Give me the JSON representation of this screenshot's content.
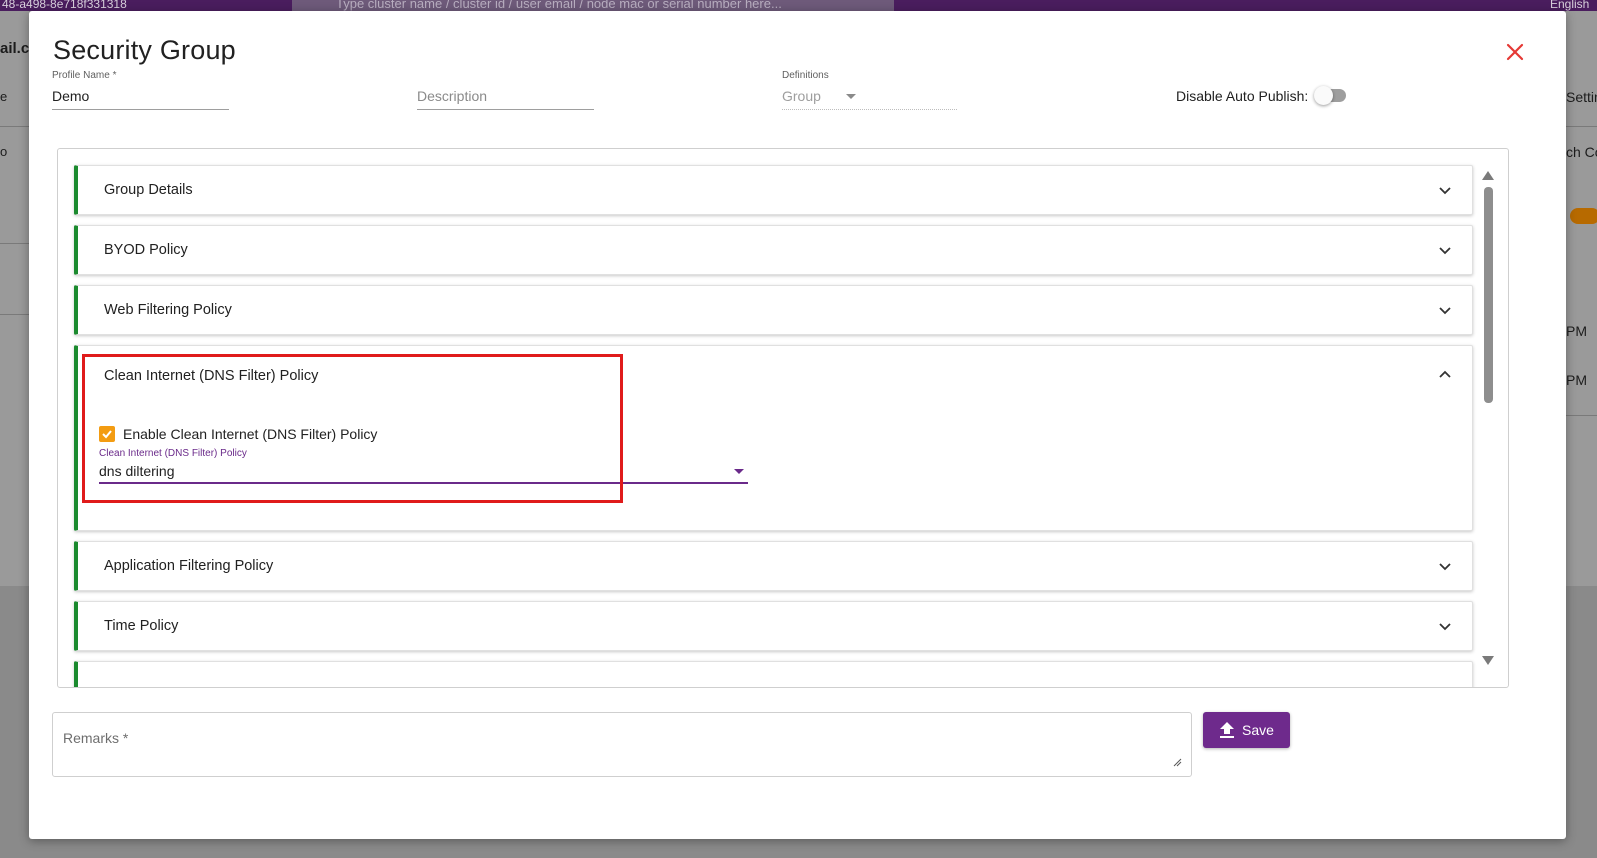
{
  "background": {
    "topbar_left_text": "48-a498-8e718f331318",
    "search_placeholder": "Type cluster name / cluster id / user email / node mac or serial number here...",
    "topbar_right_text": "English",
    "left_label": "ail.co",
    "left_label_2": "e",
    "left_label_3": "o",
    "right_label_settings": "Settin",
    "right_label_search": "ch Co",
    "right_label_pm1": "PM",
    "right_label_pm2": "PM"
  },
  "dialog": {
    "title": "Security Group",
    "profile_name": {
      "label": "Profile Name *",
      "value": "Demo"
    },
    "description": {
      "placeholder": "Description"
    },
    "definitions": {
      "label": "Definitions",
      "value": "Group"
    },
    "disable_auto_publish": {
      "label": "Disable Auto Publish:",
      "enabled": false
    }
  },
  "accordions": [
    {
      "title": "Group Details",
      "expanded": false
    },
    {
      "title": "BYOD Policy",
      "expanded": false
    },
    {
      "title": "Web Filtering Policy",
      "expanded": false
    },
    {
      "title": "Clean Internet (DNS Filter) Policy",
      "expanded": true
    },
    {
      "title": "Application Filtering Policy",
      "expanded": false
    },
    {
      "title": "Time Policy",
      "expanded": false
    }
  ],
  "dns_filter": {
    "checkbox_label": "Enable Clean Internet (DNS Filter) Policy",
    "checked": true,
    "select_label": "Clean Internet (DNS Filter) Policy",
    "select_value": "dns diltering"
  },
  "remarks": {
    "label": "Remarks *"
  },
  "save_button": {
    "label": "Save"
  },
  "colors": {
    "accent_purple": "#6e2a8c",
    "accordion_border_green": "#1b8a2e",
    "checkbox_orange": "#f39c12",
    "highlight_red": "#e01b1b",
    "close_red": "#e53935"
  },
  "icons": {
    "close": "close-icon",
    "chevron_down": "chevron-down-icon",
    "chevron_up": "chevron-up-icon",
    "check": "check-icon",
    "upload": "upload-icon",
    "resize": "resize-handle-icon"
  }
}
